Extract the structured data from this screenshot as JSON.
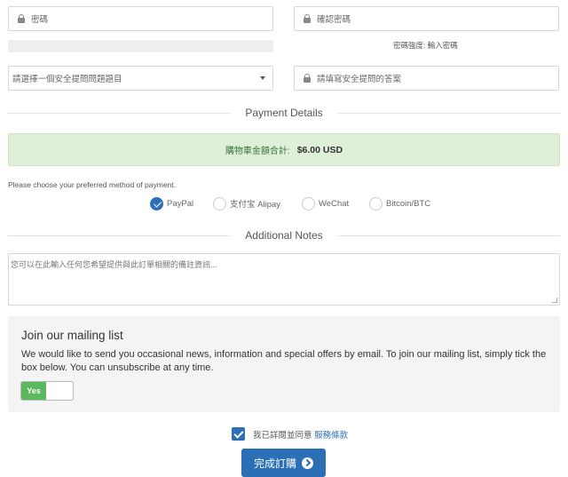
{
  "account": {
    "password_placeholder": "密碼",
    "confirm_password_placeholder": "確認密碼",
    "strength_label": "密碼強度: 輸入密碼",
    "security_question_selected": "請選擇一個安全提問問題題目",
    "security_answer_placeholder": "請填寫安全提問的答案"
  },
  "payment": {
    "section_title": "Payment Details",
    "total_label": "購物車金額合計:",
    "total_amount": "$6.00 USD",
    "prompt": "Please choose your preferred method of payment.",
    "methods": [
      {
        "label": "PayPal",
        "checked": true
      },
      {
        "label": "支付宝 Alipay",
        "checked": false
      },
      {
        "label": "WeChat",
        "checked": false
      },
      {
        "label": "Bitcoin/BTC",
        "checked": false
      }
    ]
  },
  "notes": {
    "section_title": "Additional Notes",
    "placeholder": "您可以在此輸入任何您希望提供與此訂單相關的備註資訊..."
  },
  "mailing": {
    "title": "Join our mailing list",
    "description": "We would like to send you occasional news, information and special offers by email. To join our mailing list, simply tick the box below. You can unsubscribe at any time.",
    "toggle_label": "Yes"
  },
  "terms": {
    "prefix": "我已詳閱並同意",
    "link": "服務條款"
  },
  "submit_label": "完成訂購",
  "colors": {
    "accent": "#2b6fb6",
    "success_bg": "#dff0d8",
    "toggle_on": "#5cb85c"
  }
}
